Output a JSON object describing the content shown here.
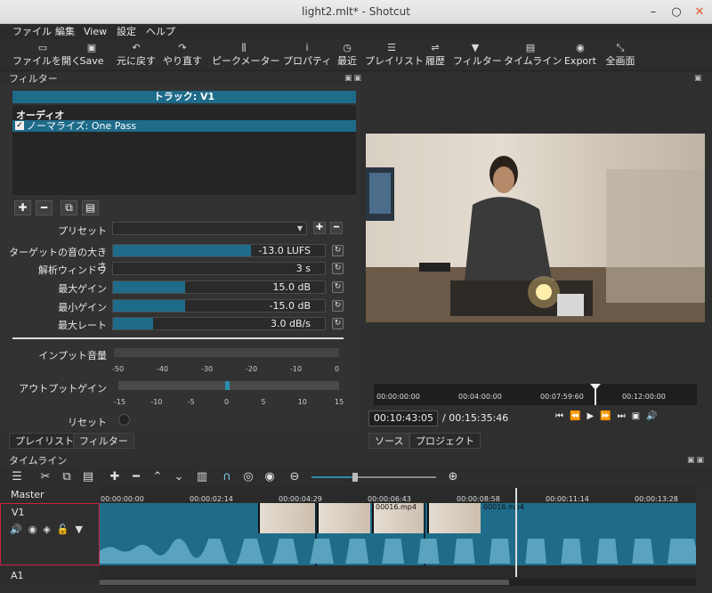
{
  "window": {
    "title": "light2.mlt* - Shotcut",
    "min": "–",
    "max": "○",
    "close": "✕"
  },
  "menu": [
    "ファイル",
    "編集",
    "View",
    "設定",
    "ヘルプ"
  ],
  "toolbar": [
    {
      "icon": "folder-icon",
      "glyph": "▭",
      "label": "ファイルを開く"
    },
    {
      "icon": "save-icon",
      "glyph": "▣",
      "label": "Save"
    },
    {
      "icon": "undo-icon",
      "glyph": "↶",
      "label": "元に戻す"
    },
    {
      "icon": "redo-icon",
      "glyph": "↷",
      "label": "やり直す"
    },
    {
      "icon": "peak-meter-icon",
      "glyph": "⫼",
      "label": "ピークメーター"
    },
    {
      "icon": "info-icon",
      "glyph": "i",
      "label": "プロパティ"
    },
    {
      "icon": "clock-icon",
      "glyph": "◷",
      "label": "最近"
    },
    {
      "icon": "list-icon",
      "glyph": "☰",
      "label": "プレイリスト"
    },
    {
      "icon": "history-icon",
      "glyph": "⇌",
      "label": "履歴"
    },
    {
      "icon": "filter-icon",
      "glyph": "▼",
      "label": "フィルター"
    },
    {
      "icon": "timeline-icon",
      "glyph": "▤",
      "label": "タイムライン"
    },
    {
      "icon": "export-icon",
      "glyph": "◉",
      "label": "Export"
    },
    {
      "icon": "fullscreen-icon",
      "glyph": "⤡",
      "label": "全画面"
    }
  ],
  "filters": {
    "dock_title": "フィルター",
    "track": "トラック: V1",
    "section": "オーディオ",
    "selected_filter": "ノーマライズ: One Pass",
    "preset_label": "プリセット",
    "params": [
      {
        "label": "ターゲットの音の大きさ",
        "value": "-13.0 LUFS",
        "fill": 0.65
      },
      {
        "label": "解析ウィンドウ",
        "value": "3 s",
        "fill": 0.0
      },
      {
        "label": "最大ゲイン",
        "value": "15.0 dB",
        "fill": 0.34
      },
      {
        "label": "最小ゲイン",
        "value": "-15.0 dB",
        "fill": 0.34
      },
      {
        "label": "最大レート",
        "value": "3.0 dB/s",
        "fill": 0.19
      }
    ],
    "input_gain_label": "インプット音量",
    "input_scale": [
      "-50",
      "-40",
      "-30",
      "-20",
      "-10",
      "0"
    ],
    "output_gain_label": "アウトプットゲイン",
    "output_scale": [
      "-15",
      "-10",
      "-5",
      "0",
      "5",
      "10",
      "15"
    ],
    "reset_label": "リセット"
  },
  "left_tabs": [
    "プレイリスト",
    "フィルター"
  ],
  "right_tabs": [
    "ソース",
    "プロジェクト"
  ],
  "player": {
    "ruler_ticks": [
      "00:00:00:00",
      "00:04:00:00",
      "00:07:59:60",
      "00:12:00:00"
    ],
    "current_tc": "00:10:43:05",
    "total_tc": "/ 00:15:35:46"
  },
  "timeline": {
    "dock_title": "タイムライン",
    "ruler": [
      "00:00:00:00",
      "00:00:02:14",
      "00:00:04:29",
      "00:00:06:43",
      "00:00:08:58",
      "00:00:11:14",
      "00:00:13:28"
    ],
    "tracks": [
      "Master",
      "V1",
      "A1"
    ],
    "clips": [
      {
        "name": "00016.mp4"
      },
      {
        "name": "00016.mp4"
      }
    ]
  }
}
